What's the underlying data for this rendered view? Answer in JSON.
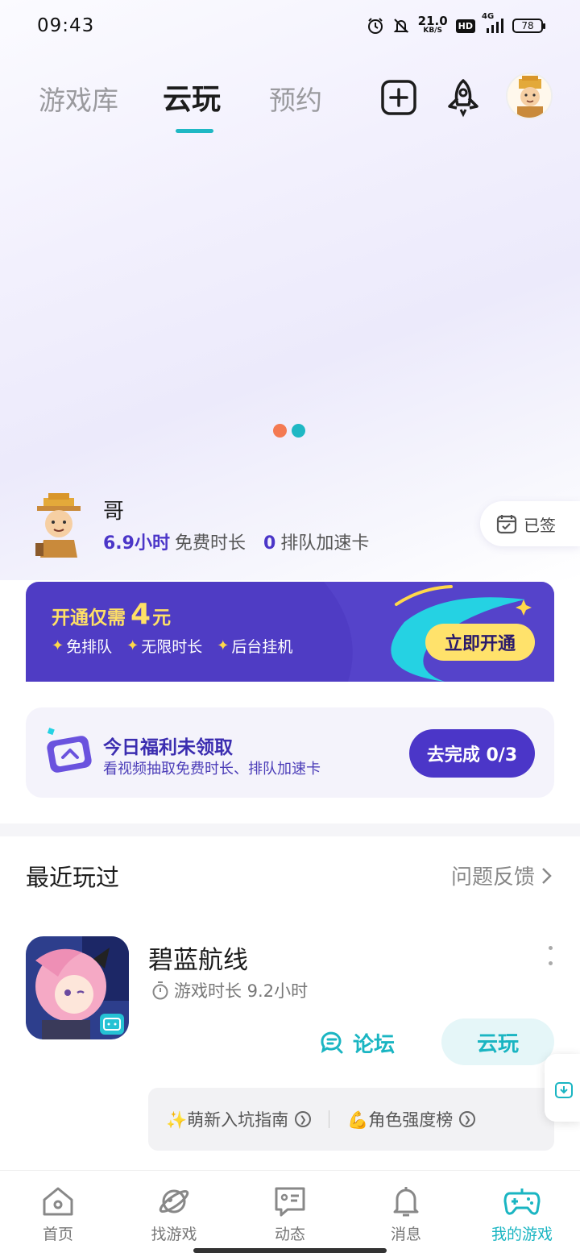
{
  "status_bar": {
    "time": "09:43",
    "net_speed_value": "21.0",
    "net_speed_unit": "KB/S",
    "hd": "HD",
    "network": "4G",
    "battery": "78"
  },
  "top_nav": {
    "tabs": [
      {
        "label": "游戏库"
      },
      {
        "label": "云玩"
      },
      {
        "label": "预约"
      }
    ],
    "active_tab": "云玩"
  },
  "carousel": {
    "dot_colors": [
      "#f47a52",
      "#1fb8c4"
    ]
  },
  "user": {
    "name": "哥",
    "free_hours": "6.9小时",
    "free_hours_label": "免费时长",
    "queue_cards": "0",
    "queue_cards_label": "排队加速卡",
    "signed_label": "已签"
  },
  "vip": {
    "title_prefix": "开通仅需",
    "price_number": "4",
    "price_unit": "元",
    "perks": [
      "免排队",
      "无限时长",
      "后台挂机"
    ],
    "button": "立即开通",
    "accent": "#ffe26b",
    "bg": "#4f3cc4"
  },
  "welfare": {
    "title": "今日福利未领取",
    "subtitle": "看视频抽取免费时长、排队加速卡",
    "button": "去完成 0/3"
  },
  "recent": {
    "title": "最近玩过",
    "feedback": "问题反馈",
    "game": {
      "name": "碧蓝航线",
      "playtime": "游戏时长 9.2小时",
      "forum_button": "论坛",
      "cloud_button": "云玩",
      "tags": [
        "✨萌新入坑指南",
        "💪角色强度榜"
      ]
    }
  },
  "bottom_nav": {
    "items": [
      {
        "label": "首页",
        "icon": "home-icon"
      },
      {
        "label": "找游戏",
        "icon": "planet-icon"
      },
      {
        "label": "动态",
        "icon": "chat-icon"
      },
      {
        "label": "消息",
        "icon": "bell-icon"
      },
      {
        "label": "我的游戏",
        "icon": "gamepad-icon"
      }
    ],
    "active": "我的游戏",
    "active_color": "#1ab5c2"
  }
}
